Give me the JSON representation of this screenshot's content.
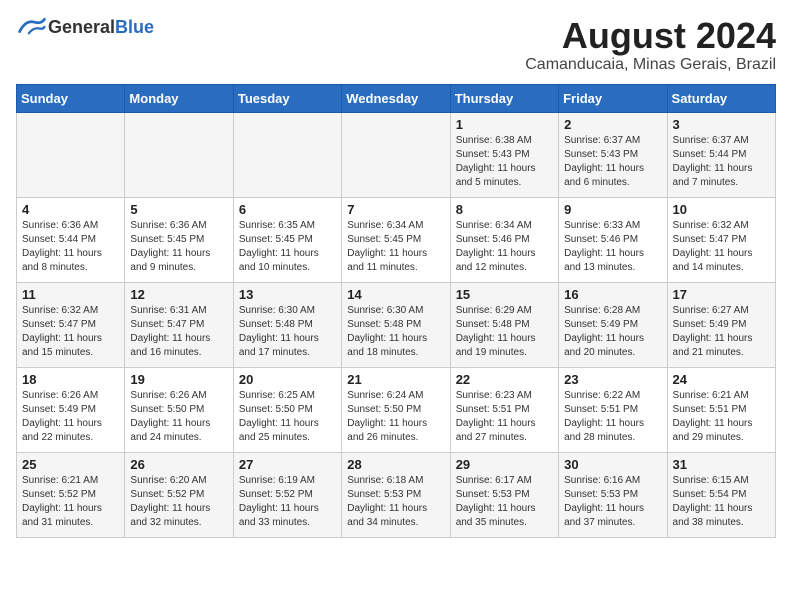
{
  "logo": {
    "text_general": "General",
    "text_blue": "Blue"
  },
  "title": "August 2024",
  "subtitle": "Camanducaia, Minas Gerais, Brazil",
  "days_of_week": [
    "Sunday",
    "Monday",
    "Tuesday",
    "Wednesday",
    "Thursday",
    "Friday",
    "Saturday"
  ],
  "weeks": [
    [
      {
        "day": "",
        "info": ""
      },
      {
        "day": "",
        "info": ""
      },
      {
        "day": "",
        "info": ""
      },
      {
        "day": "",
        "info": ""
      },
      {
        "day": "1",
        "info": "Sunrise: 6:38 AM\nSunset: 5:43 PM\nDaylight: 11 hours and 5 minutes."
      },
      {
        "day": "2",
        "info": "Sunrise: 6:37 AM\nSunset: 5:43 PM\nDaylight: 11 hours and 6 minutes."
      },
      {
        "day": "3",
        "info": "Sunrise: 6:37 AM\nSunset: 5:44 PM\nDaylight: 11 hours and 7 minutes."
      }
    ],
    [
      {
        "day": "4",
        "info": "Sunrise: 6:36 AM\nSunset: 5:44 PM\nDaylight: 11 hours and 8 minutes."
      },
      {
        "day": "5",
        "info": "Sunrise: 6:36 AM\nSunset: 5:45 PM\nDaylight: 11 hours and 9 minutes."
      },
      {
        "day": "6",
        "info": "Sunrise: 6:35 AM\nSunset: 5:45 PM\nDaylight: 11 hours and 10 minutes."
      },
      {
        "day": "7",
        "info": "Sunrise: 6:34 AM\nSunset: 5:45 PM\nDaylight: 11 hours and 11 minutes."
      },
      {
        "day": "8",
        "info": "Sunrise: 6:34 AM\nSunset: 5:46 PM\nDaylight: 11 hours and 12 minutes."
      },
      {
        "day": "9",
        "info": "Sunrise: 6:33 AM\nSunset: 5:46 PM\nDaylight: 11 hours and 13 minutes."
      },
      {
        "day": "10",
        "info": "Sunrise: 6:32 AM\nSunset: 5:47 PM\nDaylight: 11 hours and 14 minutes."
      }
    ],
    [
      {
        "day": "11",
        "info": "Sunrise: 6:32 AM\nSunset: 5:47 PM\nDaylight: 11 hours and 15 minutes."
      },
      {
        "day": "12",
        "info": "Sunrise: 6:31 AM\nSunset: 5:47 PM\nDaylight: 11 hours and 16 minutes."
      },
      {
        "day": "13",
        "info": "Sunrise: 6:30 AM\nSunset: 5:48 PM\nDaylight: 11 hours and 17 minutes."
      },
      {
        "day": "14",
        "info": "Sunrise: 6:30 AM\nSunset: 5:48 PM\nDaylight: 11 hours and 18 minutes."
      },
      {
        "day": "15",
        "info": "Sunrise: 6:29 AM\nSunset: 5:48 PM\nDaylight: 11 hours and 19 minutes."
      },
      {
        "day": "16",
        "info": "Sunrise: 6:28 AM\nSunset: 5:49 PM\nDaylight: 11 hours and 20 minutes."
      },
      {
        "day": "17",
        "info": "Sunrise: 6:27 AM\nSunset: 5:49 PM\nDaylight: 11 hours and 21 minutes."
      }
    ],
    [
      {
        "day": "18",
        "info": "Sunrise: 6:26 AM\nSunset: 5:49 PM\nDaylight: 11 hours and 22 minutes."
      },
      {
        "day": "19",
        "info": "Sunrise: 6:26 AM\nSunset: 5:50 PM\nDaylight: 11 hours and 24 minutes."
      },
      {
        "day": "20",
        "info": "Sunrise: 6:25 AM\nSunset: 5:50 PM\nDaylight: 11 hours and 25 minutes."
      },
      {
        "day": "21",
        "info": "Sunrise: 6:24 AM\nSunset: 5:50 PM\nDaylight: 11 hours and 26 minutes."
      },
      {
        "day": "22",
        "info": "Sunrise: 6:23 AM\nSunset: 5:51 PM\nDaylight: 11 hours and 27 minutes."
      },
      {
        "day": "23",
        "info": "Sunrise: 6:22 AM\nSunset: 5:51 PM\nDaylight: 11 hours and 28 minutes."
      },
      {
        "day": "24",
        "info": "Sunrise: 6:21 AM\nSunset: 5:51 PM\nDaylight: 11 hours and 29 minutes."
      }
    ],
    [
      {
        "day": "25",
        "info": "Sunrise: 6:21 AM\nSunset: 5:52 PM\nDaylight: 11 hours and 31 minutes."
      },
      {
        "day": "26",
        "info": "Sunrise: 6:20 AM\nSunset: 5:52 PM\nDaylight: 11 hours and 32 minutes."
      },
      {
        "day": "27",
        "info": "Sunrise: 6:19 AM\nSunset: 5:52 PM\nDaylight: 11 hours and 33 minutes."
      },
      {
        "day": "28",
        "info": "Sunrise: 6:18 AM\nSunset: 5:53 PM\nDaylight: 11 hours and 34 minutes."
      },
      {
        "day": "29",
        "info": "Sunrise: 6:17 AM\nSunset: 5:53 PM\nDaylight: 11 hours and 35 minutes."
      },
      {
        "day": "30",
        "info": "Sunrise: 6:16 AM\nSunset: 5:53 PM\nDaylight: 11 hours and 37 minutes."
      },
      {
        "day": "31",
        "info": "Sunrise: 6:15 AM\nSunset: 5:54 PM\nDaylight: 11 hours and 38 minutes."
      }
    ]
  ]
}
